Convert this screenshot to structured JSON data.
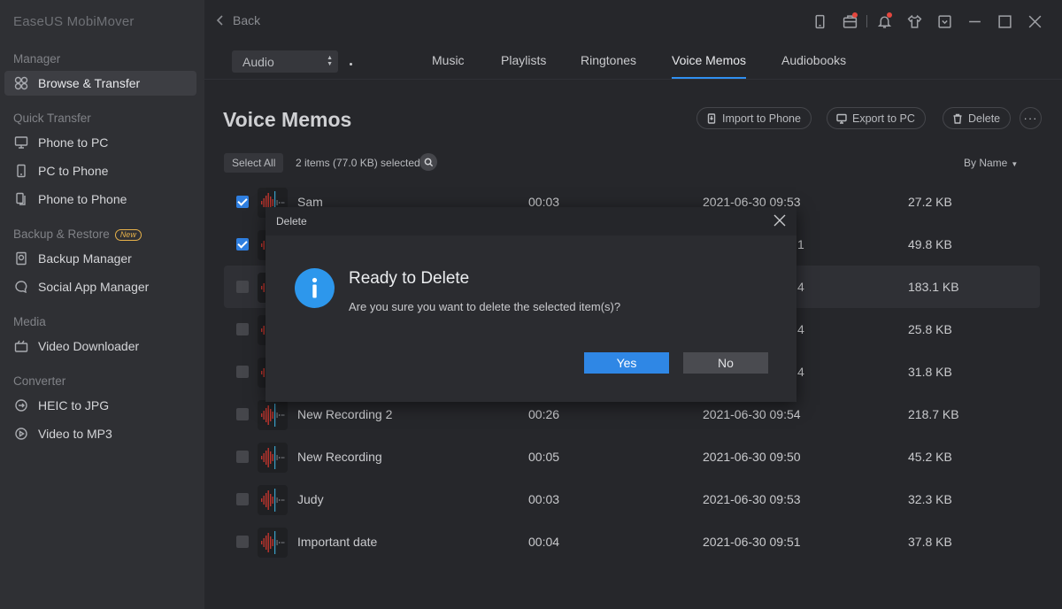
{
  "app": {
    "title": "EaseUS MobiMover"
  },
  "sidebar": {
    "sections": [
      {
        "label": "Manager",
        "items": [
          {
            "label": "Browse & Transfer",
            "icon": "grid-icon",
            "active": true
          }
        ]
      },
      {
        "label": "Quick Transfer",
        "items": [
          {
            "label": "Phone to PC",
            "icon": "monitor-icon"
          },
          {
            "label": "PC to Phone",
            "icon": "phone-icon"
          },
          {
            "label": "Phone to Phone",
            "icon": "phones-icon"
          }
        ]
      },
      {
        "label": "Backup & Restore",
        "badge": "New",
        "items": [
          {
            "label": "Backup Manager",
            "icon": "backup-icon"
          },
          {
            "label": "Social App Manager",
            "icon": "chat-icon"
          }
        ]
      },
      {
        "label": "Media",
        "items": [
          {
            "label": "Video Downloader",
            "icon": "download-icon"
          }
        ]
      },
      {
        "label": "Converter",
        "items": [
          {
            "label": "HEIC to JPG",
            "icon": "convert-icon"
          },
          {
            "label": "Video to MP3",
            "icon": "video-convert-icon"
          }
        ]
      }
    ]
  },
  "header": {
    "back_label": "Back"
  },
  "filter": {
    "category": "Audio"
  },
  "tabs": [
    {
      "label": "Music"
    },
    {
      "label": "Playlists"
    },
    {
      "label": "Ringtones"
    },
    {
      "label": "Voice Memos",
      "active": true
    },
    {
      "label": "Audiobooks"
    }
  ],
  "page": {
    "title": "Voice Memos",
    "actions": {
      "import": "Import to Phone",
      "export": "Export to PC",
      "delete": "Delete",
      "more": "···"
    },
    "select_all": "Select All",
    "selection_info": "2 items (77.0 KB) selected",
    "sort_label": "By Name"
  },
  "rows": [
    {
      "name": "Sam",
      "duration": "00:03",
      "date": "2021-06-30 09:53",
      "size": "27.2 KB",
      "checked": true
    },
    {
      "name": "",
      "duration": "",
      "date": "1",
      "size": "49.8 KB",
      "checked": true
    },
    {
      "name": "",
      "duration": "",
      "date": "4",
      "size": "183.1 KB",
      "checked": false,
      "highlight": true
    },
    {
      "name": "",
      "duration": "",
      "date": "4",
      "size": "25.8 KB",
      "checked": false
    },
    {
      "name": "",
      "duration": "",
      "date": "4",
      "size": "31.8 KB",
      "checked": false
    },
    {
      "name": "New Recording 2",
      "duration": "00:26",
      "date": "2021-06-30 09:54",
      "size": "218.7 KB",
      "checked": false
    },
    {
      "name": "New Recording",
      "duration": "00:05",
      "date": "2021-06-30 09:50",
      "size": "45.2 KB",
      "checked": false
    },
    {
      "name": "Judy",
      "duration": "00:03",
      "date": "2021-06-30 09:53",
      "size": "32.3 KB",
      "checked": false
    },
    {
      "name": "Important date",
      "duration": "00:04",
      "date": "2021-06-30 09:51",
      "size": "37.8 KB",
      "checked": false
    }
  ],
  "dialog": {
    "title": "Delete",
    "heading": "Ready to Delete",
    "message": "Are you sure you want to delete the selected item(s)?",
    "yes": "Yes",
    "no": "No"
  },
  "colors": {
    "accent": "#2f87e5",
    "info": "#2d97ec",
    "notification": "#e4473f",
    "badge": "#e7b24a"
  }
}
